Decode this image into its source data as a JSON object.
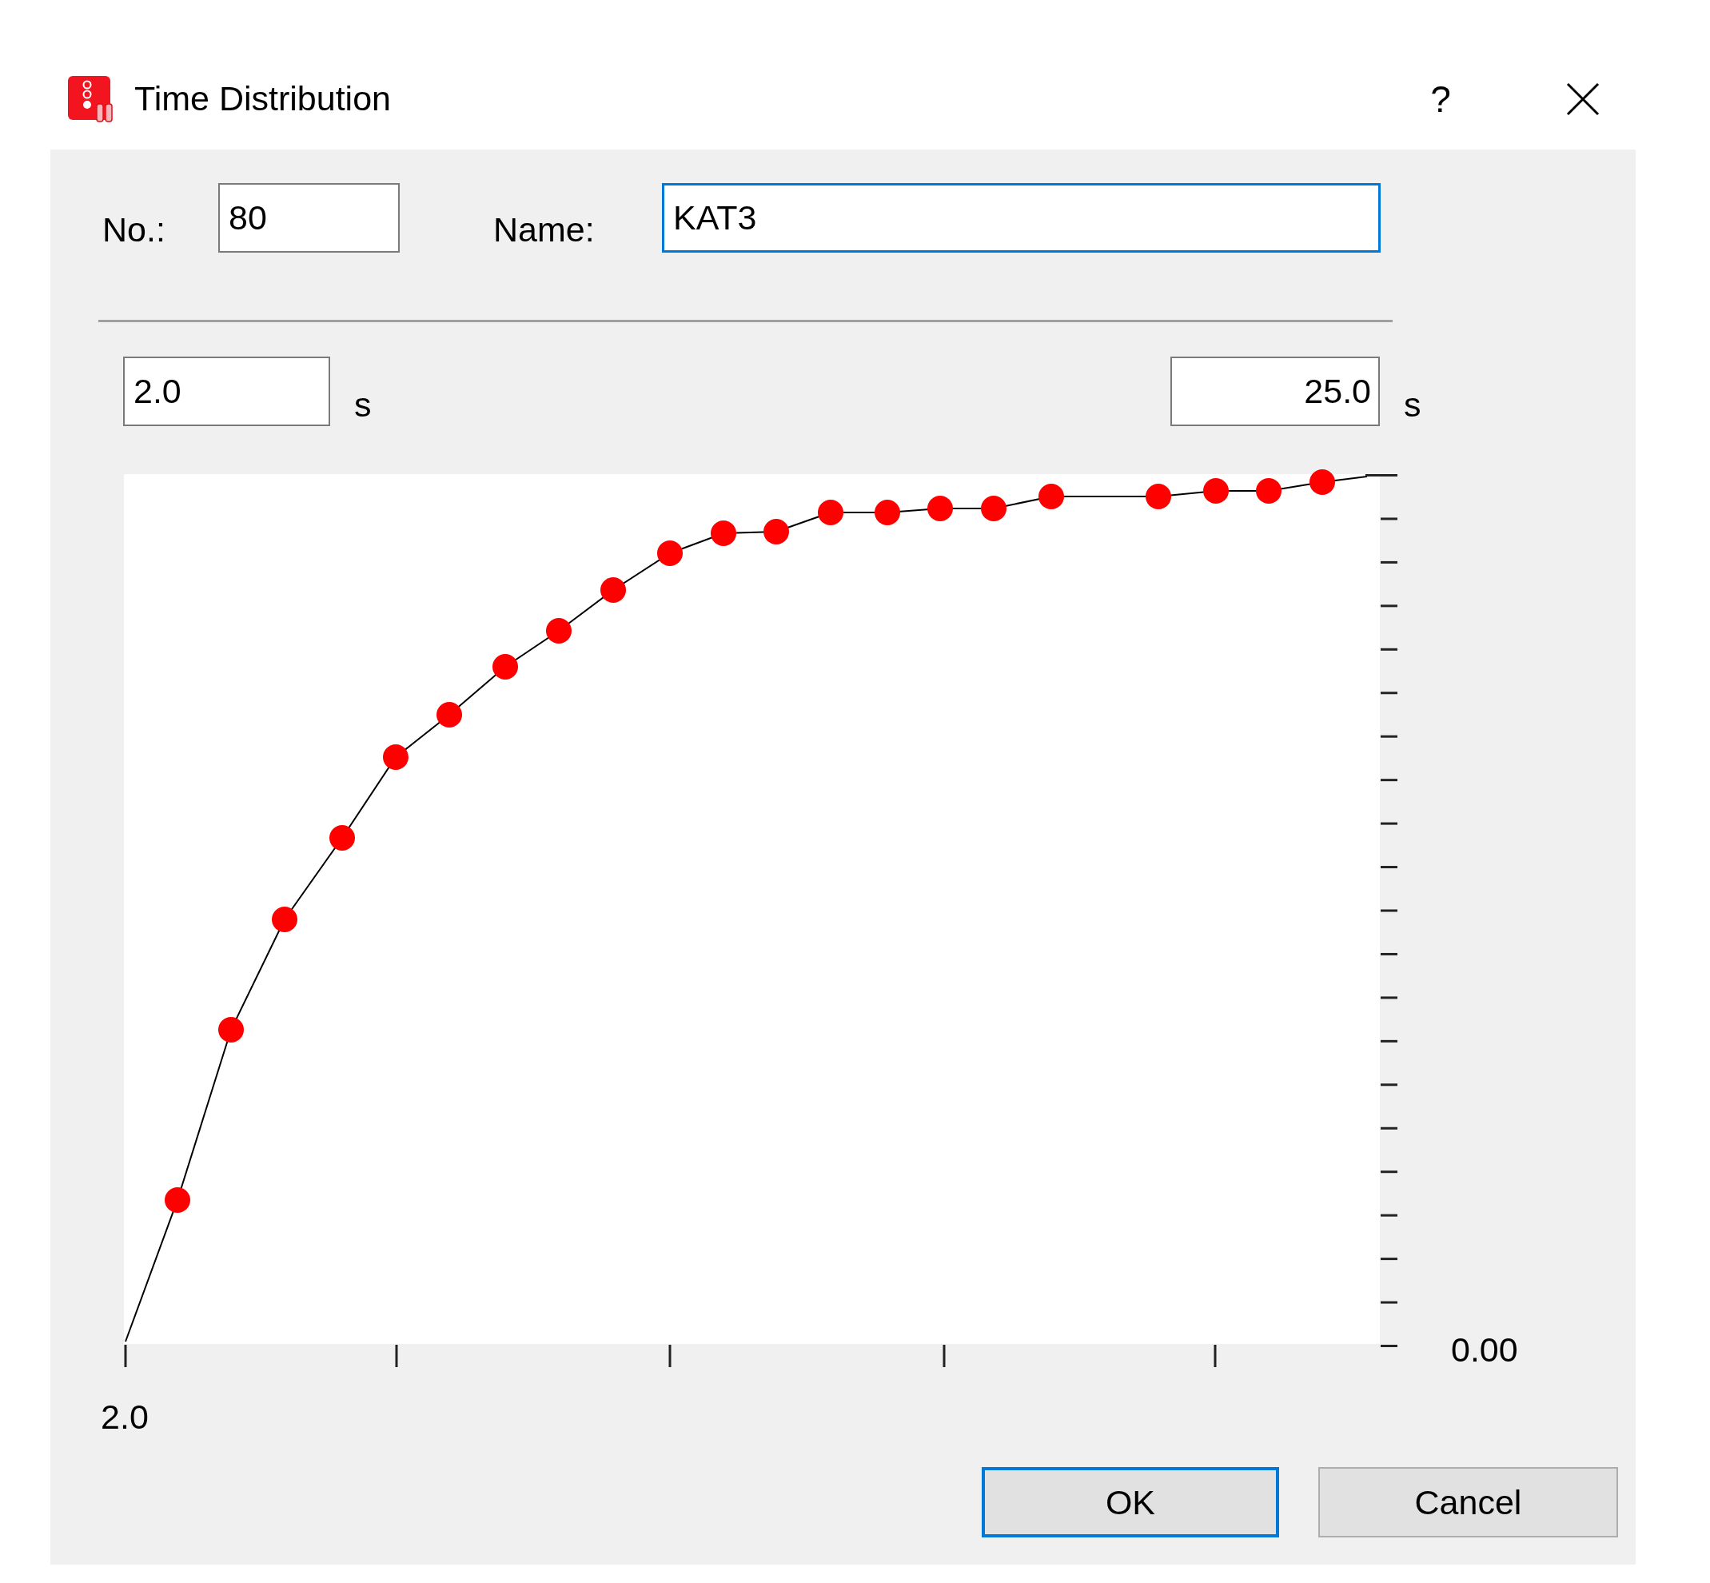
{
  "window": {
    "title": "Time Distribution",
    "help_button": "?"
  },
  "fields": [
    {
      "label": "No.:",
      "value": "80",
      "focused": false
    },
    {
      "label": "Name:",
      "value": "KAT3",
      "focused": true
    }
  ],
  "range": [
    {
      "value": "2.0",
      "unit": "s"
    },
    {
      "value": "25.0",
      "unit": "s"
    }
  ],
  "chart": {
    "x_axis_label": "2.0",
    "y_axis_label": "0.00"
  },
  "buttons": [
    {
      "label": "OK",
      "default": true
    },
    {
      "label": "Cancel",
      "default": false
    }
  ]
}
